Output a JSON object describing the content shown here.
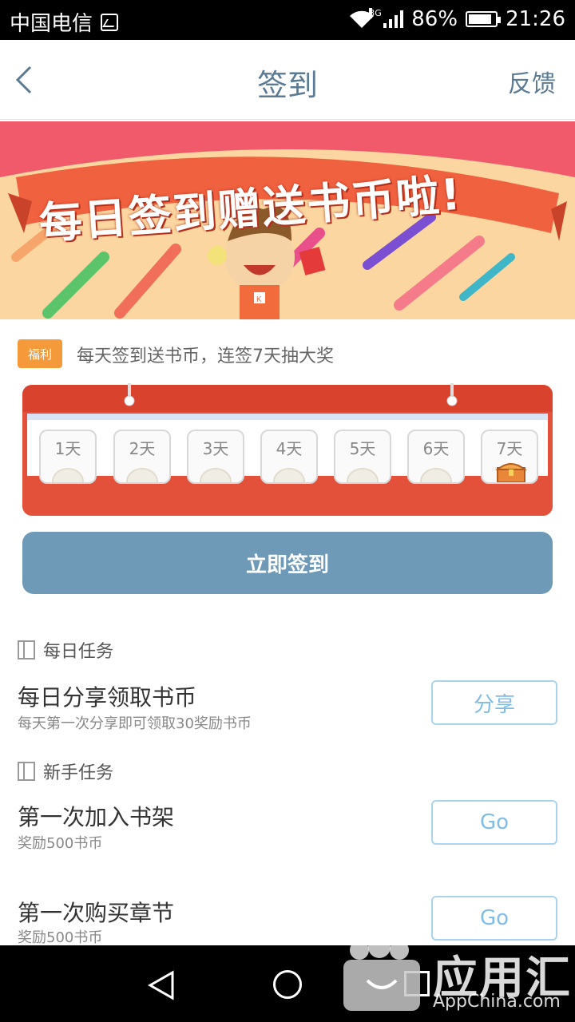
{
  "status_bar": {
    "carrier": "中国电信",
    "network": "3G",
    "battery_percent": "86%",
    "battery_level": 0.86,
    "time": "21:26"
  },
  "header": {
    "title": "签到",
    "feedback_label": "反馈"
  },
  "banner": {
    "headline": "每日签到赠送书币啦!",
    "mascot_badge": "K"
  },
  "welfare": {
    "badge": "福利",
    "text": "每天签到送书币，连签7天抽大奖"
  },
  "calendar": {
    "days": [
      {
        "label": "1天"
      },
      {
        "label": "2天"
      },
      {
        "label": "3天"
      },
      {
        "label": "4天"
      },
      {
        "label": "5天"
      },
      {
        "label": "6天"
      },
      {
        "label": "7天"
      }
    ]
  },
  "sign_button": "立即签到",
  "daily_tasks": {
    "heading": "每日任务",
    "items": [
      {
        "title": "每日分享领取书币",
        "subtitle": "每天第一次分享即可领取30奖励书币",
        "button": "分享"
      }
    ]
  },
  "newbie_tasks": {
    "heading": "新手任务",
    "items": [
      {
        "title": "第一次加入书架",
        "subtitle": "奖励500书币",
        "button": "Go"
      },
      {
        "title": "第一次购买章节",
        "subtitle": "奖励500书币",
        "button": "Go"
      }
    ]
  },
  "watermark": {
    "name": "应用汇",
    "site": "AppChina.com"
  },
  "colors": {
    "title_blue": "#5b7a94",
    "sign_button": "#6f9ab7",
    "calendar_red": "#e3513b",
    "welfare_orange": "#f49a3a",
    "task_button_border": "#a9d3ef"
  }
}
